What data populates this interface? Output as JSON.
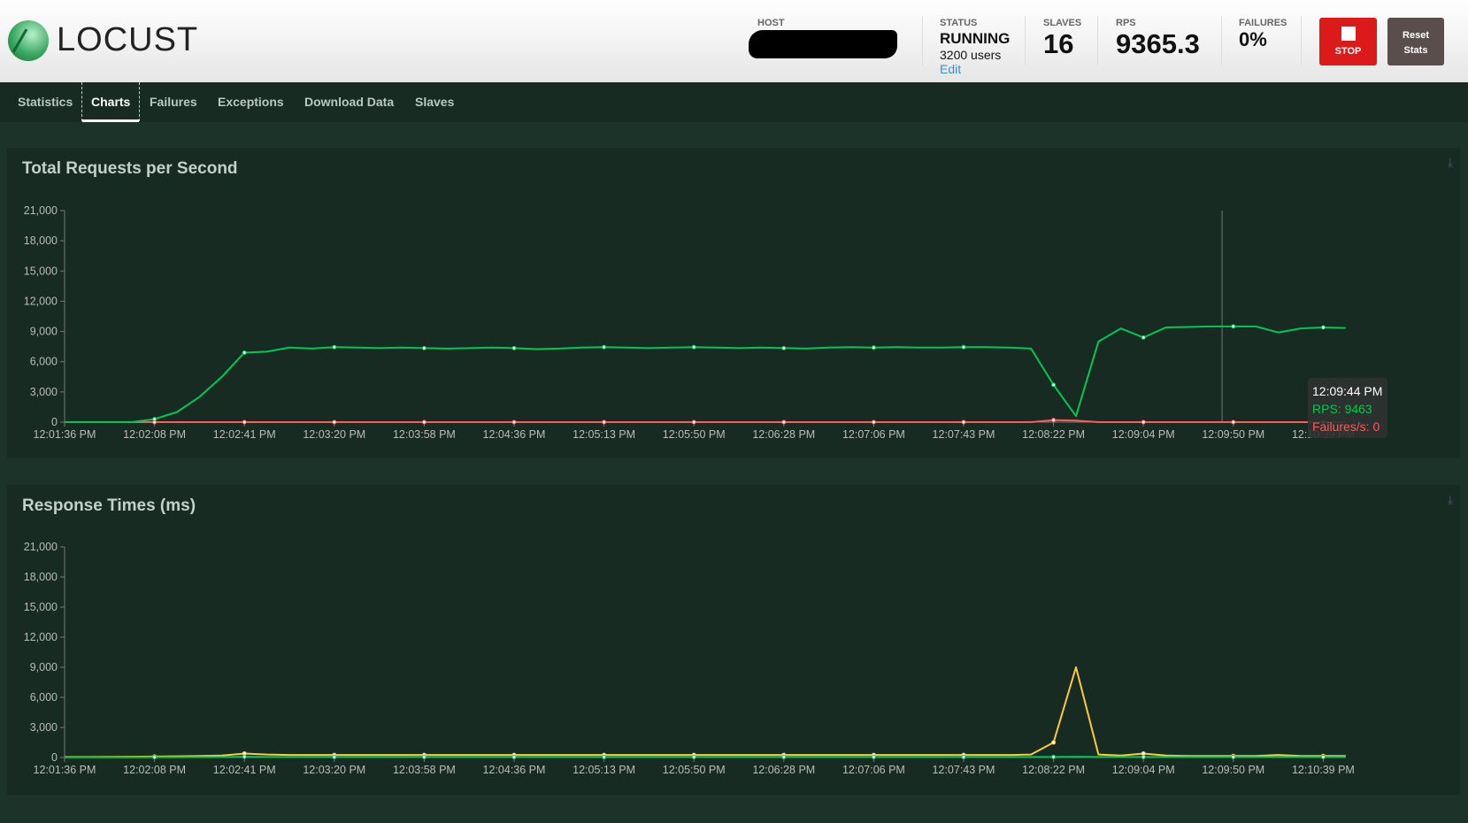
{
  "header": {
    "logo_text": "LOCUST",
    "host_label": "HOST",
    "status_label": "STATUS",
    "status": "RUNNING",
    "users": "3200 users",
    "edit": "Edit",
    "slaves_label": "SLAVES",
    "slaves": "16",
    "rps_label": "RPS",
    "rps": "9365.3",
    "failures_label": "FAILURES",
    "failures": "0%",
    "stop": "STOP",
    "reset_line1": "Reset",
    "reset_line2": "Stats"
  },
  "nav": {
    "items": [
      "Statistics",
      "Charts",
      "Failures",
      "Exceptions",
      "Download Data",
      "Slaves"
    ],
    "active": "Charts"
  },
  "colors": {
    "rps": "#00c853",
    "failures": "#ff5a5a",
    "median": "#00c853",
    "percentile": "#ffca3a"
  },
  "chart_data": [
    {
      "type": "line",
      "title": "Total Requests per Second",
      "ylim": [
        0,
        21000
      ],
      "yticks": [
        "0",
        "3,000",
        "6,000",
        "9,000",
        "12,000",
        "15,000",
        "18,000",
        "21,000"
      ],
      "x_tick_labels": [
        "12:01:36 PM",
        "12:02:08 PM",
        "12:02:41 PM",
        "12:03:20 PM",
        "12:03:58 PM",
        "12:04:36 PM",
        "12:05:13 PM",
        "12:05:50 PM",
        "12:06:28 PM",
        "12:07:06 PM",
        "12:07:43 PM",
        "12:08:22 PM",
        "12:09:04 PM",
        "12:09:50 PM",
        "12:10:39 PM"
      ],
      "series": [
        {
          "name": "RPS",
          "values": [
            0,
            0,
            0,
            0,
            300,
            1000,
            2500,
            4500,
            6900,
            7000,
            7400,
            7300,
            7450,
            7400,
            7350,
            7400,
            7350,
            7300,
            7350,
            7400,
            7350,
            7250,
            7300,
            7400,
            7450,
            7400,
            7350,
            7400,
            7450,
            7400,
            7350,
            7400,
            7350,
            7300,
            7400,
            7450,
            7400,
            7450,
            7400,
            7400,
            7450,
            7450,
            7400,
            7300,
            3700,
            600,
            8000,
            9300,
            8400,
            9400,
            9450,
            9500,
            9500,
            9500,
            8900,
            9300,
            9400,
            9350
          ]
        },
        {
          "name": "Failures/s",
          "values": [
            0,
            0,
            0,
            0,
            0,
            0,
            0,
            0,
            0,
            0,
            0,
            0,
            0,
            0,
            0,
            0,
            0,
            0,
            0,
            0,
            0,
            0,
            0,
            0,
            0,
            0,
            0,
            0,
            0,
            0,
            0,
            0,
            0,
            0,
            0,
            0,
            0,
            0,
            0,
            0,
            0,
            0,
            0,
            0,
            200,
            150,
            0,
            0,
            0,
            0,
            0,
            0,
            0,
            0,
            0,
            0,
            0,
            0
          ]
        }
      ],
      "tooltip": {
        "time": "12:09:44 PM",
        "rps": "RPS: 9463",
        "failures": "Failures/s: 0"
      }
    },
    {
      "type": "line",
      "title": "Response Times (ms)",
      "ylim": [
        0,
        21000
      ],
      "yticks": [
        "0",
        "3,000",
        "6,000",
        "9,000",
        "12,000",
        "15,000",
        "18,000",
        "21,000"
      ],
      "x_tick_labels": [
        "12:01:36 PM",
        "12:02:08 PM",
        "12:02:41 PM",
        "12:03:20 PM",
        "12:03:58 PM",
        "12:04:36 PM",
        "12:05:13 PM",
        "12:05:50 PM",
        "12:06:28 PM",
        "12:07:06 PM",
        "12:07:43 PM",
        "12:08:22 PM",
        "12:09:04 PM",
        "12:09:50 PM",
        "12:10:39 PM"
      ],
      "series": [
        {
          "values": [
            20,
            20,
            20,
            20,
            30,
            30,
            40,
            50,
            80,
            60,
            50,
            50,
            50,
            50,
            50,
            50,
            50,
            50,
            50,
            50,
            50,
            50,
            50,
            50,
            50,
            50,
            50,
            50,
            50,
            50,
            50,
            50,
            50,
            50,
            50,
            50,
            50,
            50,
            50,
            50,
            50,
            50,
            50,
            50,
            60,
            80,
            50,
            50,
            60,
            50,
            50,
            50,
            50,
            50,
            50,
            50,
            50,
            50
          ]
        },
        {
          "values": [
            50,
            60,
            70,
            80,
            100,
            120,
            150,
            200,
            400,
            300,
            250,
            250,
            250,
            250,
            250,
            250,
            250,
            250,
            250,
            250,
            250,
            250,
            250,
            250,
            250,
            250,
            250,
            250,
            250,
            250,
            250,
            250,
            250,
            250,
            250,
            250,
            250,
            250,
            250,
            250,
            250,
            250,
            250,
            300,
            1500,
            9000,
            300,
            200,
            400,
            200,
            150,
            150,
            150,
            150,
            250,
            150,
            150,
            150
          ]
        }
      ]
    }
  ]
}
